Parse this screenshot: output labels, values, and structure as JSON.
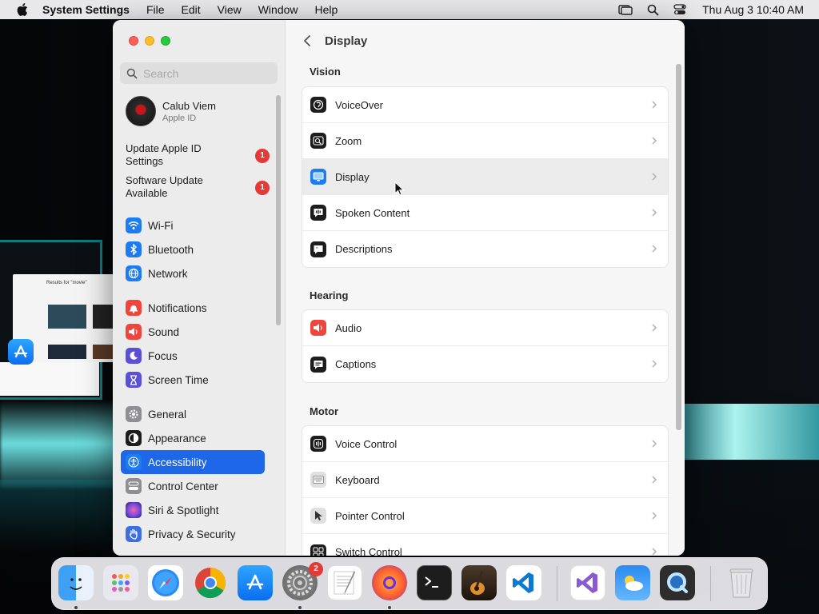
{
  "menubar": {
    "app_name": "System Settings",
    "menus": [
      "File",
      "Edit",
      "View",
      "Window",
      "Help"
    ],
    "clock": "Thu Aug 3  10:40 AM"
  },
  "desktop": {
    "thumbnail_title": "Results for \"movie\""
  },
  "sidebar": {
    "search_placeholder": "Search",
    "account": {
      "name": "Calub Viem",
      "subtitle": "Apple ID"
    },
    "notices": [
      {
        "label": "Update Apple ID Settings",
        "badge": "1"
      },
      {
        "label": "Software Update Available",
        "badge": "1"
      }
    ],
    "items": [
      {
        "label": "Wi-Fi",
        "icon": "wifi-icon",
        "color": "#1e7cf2"
      },
      {
        "label": "Bluetooth",
        "icon": "bluetooth-icon",
        "color": "#1e7cf2"
      },
      {
        "label": "Network",
        "icon": "globe-icon",
        "color": "#1e7cf2"
      },
      {
        "label": "Notifications",
        "icon": "bell-icon",
        "color": "#f0453c"
      },
      {
        "label": "Sound",
        "icon": "speaker-icon",
        "color": "#f0453c"
      },
      {
        "label": "Focus",
        "icon": "moon-icon",
        "color": "#5a4fd6"
      },
      {
        "label": "Screen Time",
        "icon": "hourglass-icon",
        "color": "#5a4fd6"
      },
      {
        "label": "General",
        "icon": "gear-icon",
        "color": "#8e8e93"
      },
      {
        "label": "Appearance",
        "icon": "appearance-icon",
        "color": "#1d1d1d"
      },
      {
        "label": "Accessibility",
        "icon": "accessibility-icon",
        "color": "#1e7cf2"
      },
      {
        "label": "Control Center",
        "icon": "control-center-icon",
        "color": "#8e8e93"
      },
      {
        "label": "Siri & Spotlight",
        "icon": "siri-icon",
        "color": "#b04ad8"
      },
      {
        "label": "Privacy & Security",
        "icon": "hand-icon",
        "color": "#3d6fe0"
      }
    ],
    "active_item": "Accessibility"
  },
  "content": {
    "title": "Display",
    "sections": [
      {
        "title": "Vision",
        "rows": [
          {
            "label": "VoiceOver",
            "icon": "voiceover-icon"
          },
          {
            "label": "Zoom",
            "icon": "zoom-icon"
          },
          {
            "label": "Display",
            "icon": "display-icon"
          },
          {
            "label": "Spoken Content",
            "icon": "spoken-content-icon"
          },
          {
            "label": "Descriptions",
            "icon": "descriptions-icon"
          }
        ]
      },
      {
        "title": "Hearing",
        "rows": [
          {
            "label": "Audio",
            "icon": "audio-icon"
          },
          {
            "label": "Captions",
            "icon": "captions-icon"
          }
        ]
      },
      {
        "title": "Motor",
        "rows": [
          {
            "label": "Voice Control",
            "icon": "voice-control-icon"
          },
          {
            "label": "Keyboard",
            "icon": "keyboard-icon"
          },
          {
            "label": "Pointer Control",
            "icon": "pointer-control-icon"
          },
          {
            "label": "Switch Control",
            "icon": "switch-control-icon"
          }
        ]
      }
    ],
    "hovered_row": "Display"
  },
  "dock": {
    "apps": [
      "Finder",
      "Launchpad",
      "Safari",
      "Chrome",
      "App Store",
      "System Settings",
      "TextEdit",
      "Firefox",
      "Terminal",
      "GarageBand",
      "Visual Studio Code",
      "Visual Studio",
      "Weather",
      "QuickTime Player",
      "Trash"
    ],
    "settings_badge": "2"
  }
}
